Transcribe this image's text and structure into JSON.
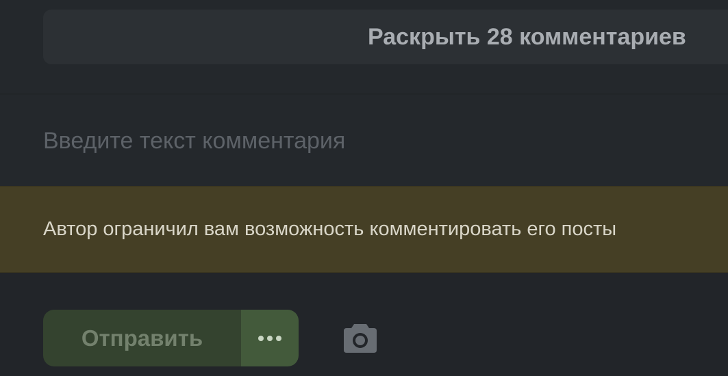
{
  "comments": {
    "expand_label": "Раскрыть 28 комментариев"
  },
  "comment_input": {
    "placeholder": "Введите текст комментария",
    "value": ""
  },
  "restriction": {
    "message": "Автор ограничил вам возможность комментировать его посты"
  },
  "actions": {
    "send_label": "Отправить",
    "more_icon": "more-horizontal-icon",
    "camera_icon": "camera-icon"
  },
  "colors": {
    "background": "#222529",
    "expand_button_bg": "#2c3034",
    "restriction_bg": "#453f25",
    "send_button_bg": "#34432f",
    "more_button_bg": "#435a3b"
  }
}
